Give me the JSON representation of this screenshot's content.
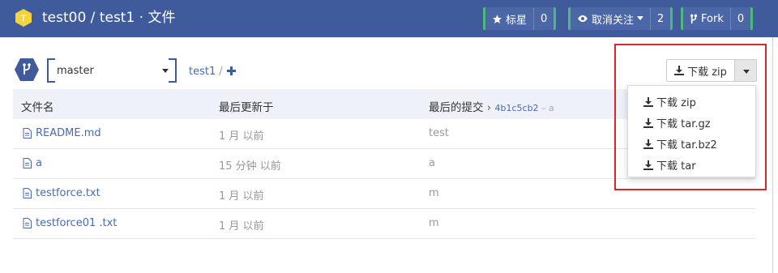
{
  "header": {
    "logo_letter": "T",
    "title": "test00 / test1 · 文件",
    "star": {
      "label": "标星",
      "count": "0"
    },
    "watch": {
      "label": "取消关注",
      "count": "2"
    },
    "fork": {
      "label": "Fork",
      "count": "0"
    }
  },
  "branch": {
    "selected": "master",
    "breadcrumb_root": "test1",
    "breadcrumb_sep": "/"
  },
  "download": {
    "button_label": "下载 zip",
    "menu": [
      "下载 zip",
      "下载 tar.gz",
      "下载 tar.bz2",
      "下载 tar"
    ]
  },
  "table": {
    "headers": {
      "name": "文件名",
      "updated": "最后更新于",
      "commit": "最后的提交"
    },
    "last_commit": {
      "id": "4b1c5cb2",
      "sub": " – a"
    },
    "rows": [
      {
        "name": "README.md",
        "time": "1 月 以前",
        "message": "test"
      },
      {
        "name": "a",
        "time": "15 分钟 以前",
        "message": "a"
      },
      {
        "name": "testforce.txt",
        "time": "1 月 以前",
        "message": "m"
      },
      {
        "name": "testforce01 .txt",
        "time": "1 月 以前",
        "message": "m"
      }
    ]
  },
  "colors": {
    "header_bg": "#3f5b9c",
    "accent_green": "#4dba7c",
    "link_blue": "#4a6ab2",
    "highlight_red": "#e0252a",
    "logo_yellow": "#f5d33b"
  }
}
